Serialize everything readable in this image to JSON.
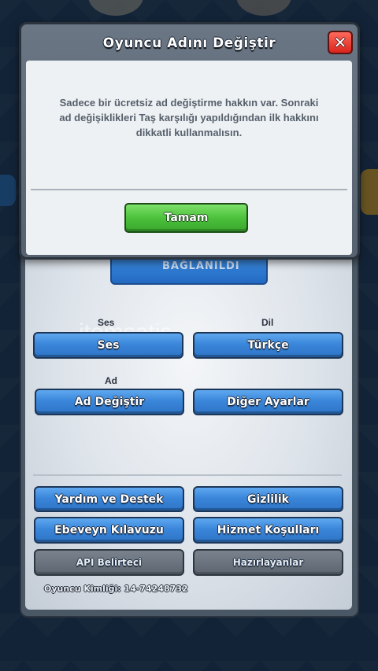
{
  "dialog": {
    "title": "Oyuncu Adını Değiştir",
    "message": "Sadece bir ücretsiz ad değiştirme hakkın var. Sonraki ad değişiklikleri Taş karşılığı yapıldığından ilk hakkını dikkatli kullanmalısın.",
    "ok_label": "Tamam",
    "close_glyph": "✕"
  },
  "settings": {
    "linked_label": "BAĞLANILDI",
    "sound_label": "Ses",
    "sound_button": "Ses",
    "language_label": "Dil",
    "language_button": "Türkçe",
    "name_label": "Ad",
    "change_name_button": "Ad Değiştir",
    "other_settings_button": "Diğer Ayarlar",
    "help_button": "Yardım ve Destek",
    "privacy_button": "Gizlilik",
    "parents_guide_button": "Ebeveyn Kılavuzu",
    "terms_button": "Hizmet Koşulları",
    "api_button": "API Belirteci",
    "credits_button": "Hazırlayanlar",
    "player_id": "Oyuncu Kimliği: 14-74248732"
  },
  "watermark": "itemsatis",
  "colors": {
    "accent_blue": "#3a86da",
    "ok_green": "#4cc23c",
    "close_red": "#d9241c"
  }
}
